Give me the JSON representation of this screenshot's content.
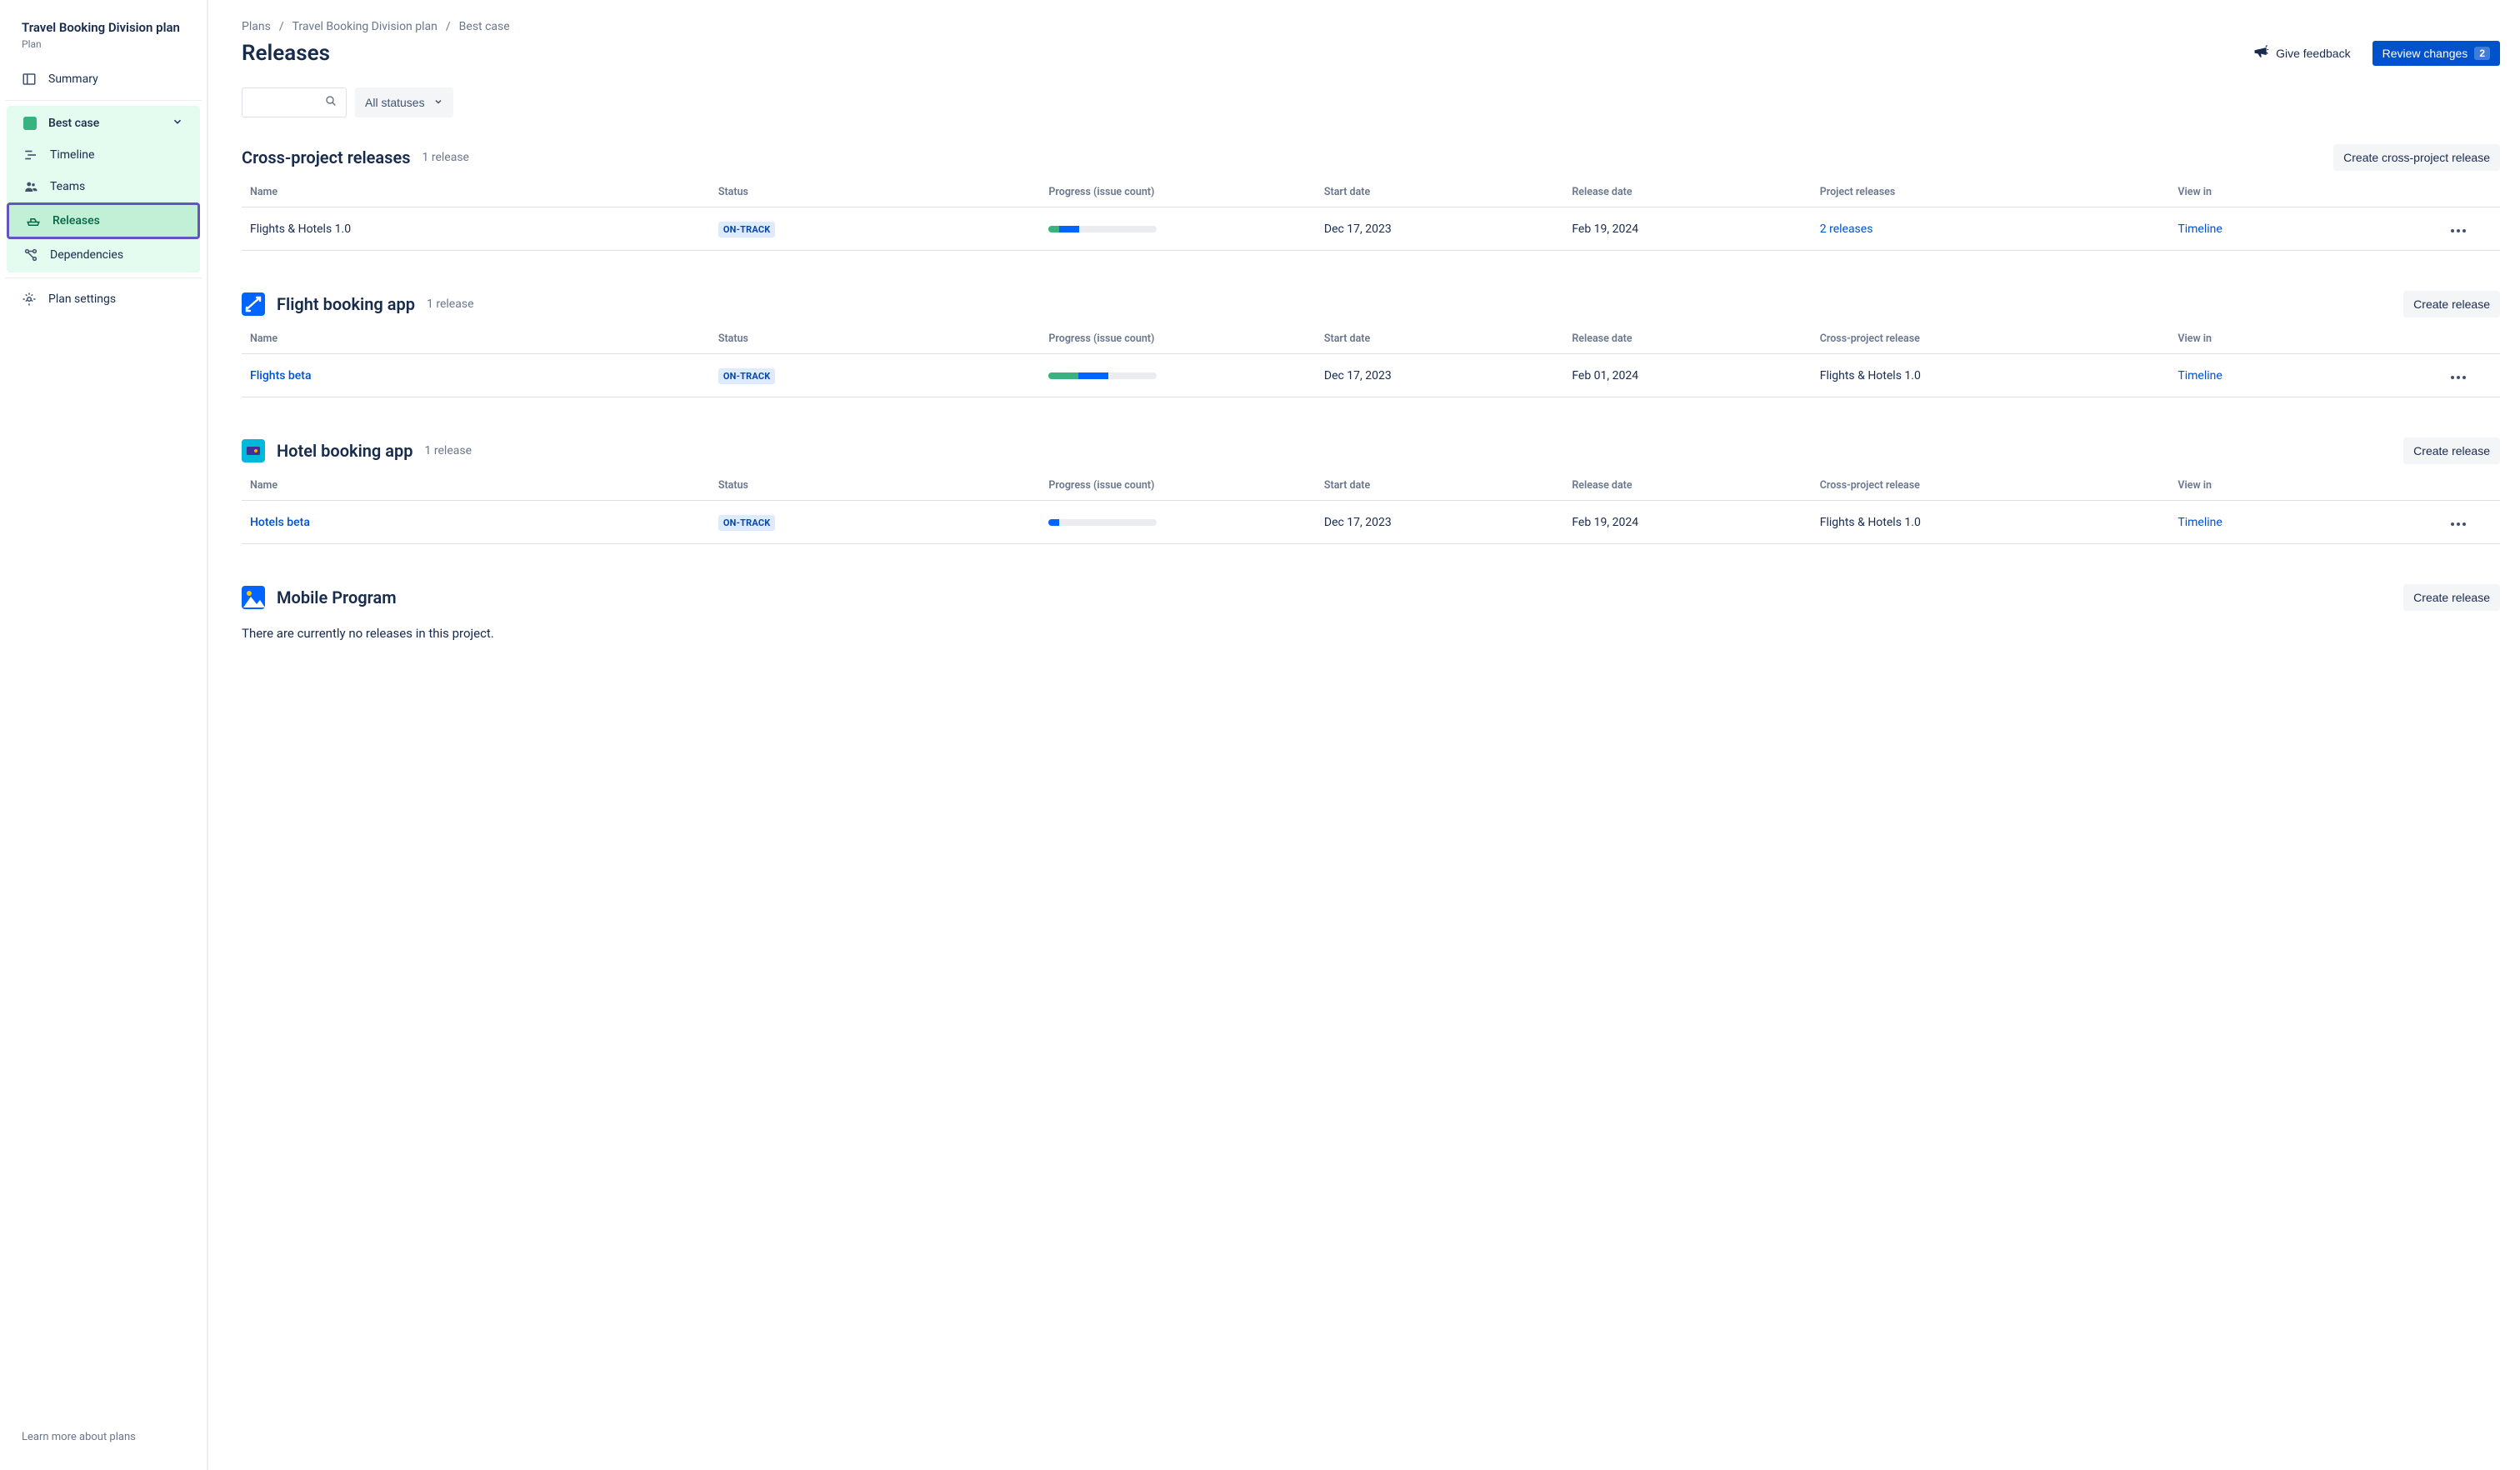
{
  "sidebar": {
    "plan_title": "Travel Booking Division plan",
    "plan_subtitle": "Plan",
    "summary": "Summary",
    "group_head": "Best case",
    "timeline": "Timeline",
    "teams": "Teams",
    "releases": "Releases",
    "dependencies": "Dependencies",
    "settings": "Plan settings",
    "footer": "Learn more about plans"
  },
  "breadcrumb": {
    "plans": "Plans",
    "plan_name": "Travel Booking Division plan",
    "scenario": "Best case"
  },
  "header": {
    "title": "Releases",
    "feedback": "Give feedback",
    "review": "Review changes",
    "review_count": "2"
  },
  "filters": {
    "status_label": "All statuses"
  },
  "cols": {
    "name": "Name",
    "status": "Status",
    "progress": "Progress (issue count)",
    "start": "Start date",
    "release": "Release date",
    "project_releases": "Project releases",
    "cross_project": "Cross-project release",
    "view_in": "View in"
  },
  "sections": {
    "cross": {
      "title": "Cross-project releases",
      "count": "1 release",
      "create": "Create cross-project release",
      "row": {
        "name": "Flights & Hotels 1.0",
        "status": "ON-TRACK",
        "start": "Dec 17, 2023",
        "release": "Feb 19, 2024",
        "projects": "2 releases",
        "view": "Timeline",
        "progress_green": 10,
        "progress_blue": 18
      }
    },
    "flight": {
      "title": "Flight booking app",
      "count": "1 release",
      "create": "Create release",
      "row": {
        "name": "Flights beta",
        "status": "ON-TRACK",
        "start": "Dec 17, 2023",
        "release": "Feb 01, 2024",
        "cross": "Flights & Hotels 1.0",
        "view": "Timeline",
        "progress_green": 27,
        "progress_blue": 28
      }
    },
    "hotel": {
      "title": "Hotel booking app",
      "count": "1 release",
      "create": "Create release",
      "row": {
        "name": "Hotels beta",
        "status": "ON-TRACK",
        "start": "Dec 17, 2023",
        "release": "Feb 19, 2024",
        "cross": "Flights & Hotels 1.0",
        "view": "Timeline",
        "progress_green": 0,
        "progress_blue": 10
      }
    },
    "mobile": {
      "title": "Mobile Program",
      "create": "Create release",
      "empty": "There are currently no releases in this project."
    }
  }
}
